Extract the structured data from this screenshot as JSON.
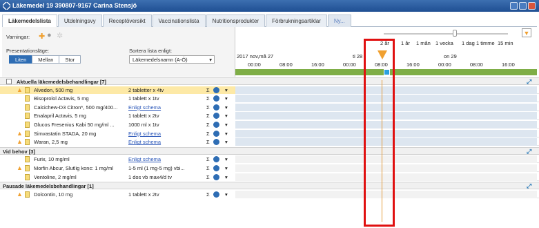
{
  "window": {
    "title": "Läkemedel 19 390807-9167 Carina Stensjö"
  },
  "tabs": [
    "Läkemedelslista",
    "Utdelningsvy",
    "Receptöversikt",
    "Vaccinationslista",
    "Nutritionsprodukter",
    "Förbrukningsartiklar",
    "Ny..."
  ],
  "controls": {
    "warnings_label": "Varningar:",
    "presentation_label": "Presentationsläge:",
    "modes": [
      "Liten",
      "Mellan",
      "Stor"
    ],
    "sort_label": "Sortera lista enligt:",
    "sort_value": "Läkemedelsnamn (A-Ö)"
  },
  "zoom": [
    "2 år",
    "1 år",
    "1 mån",
    "1 vecka",
    "1 dag",
    "1 timme",
    "15 min"
  ],
  "timeline": {
    "date_left": "2017 nov,må 27",
    "date_mid": "ti 28",
    "date_right": "on 29",
    "hours": [
      "00:00",
      "08:00",
      "16:00",
      "00:00",
      "08:00",
      "16:00",
      "00:00",
      "08:00",
      "16:00"
    ]
  },
  "sections": [
    {
      "title": "Aktuella läkemedelsbehandlingar [7]",
      "rows": [
        {
          "name": "Alvedon, 500 mg",
          "dose": "2 tabletter x 4tv",
          "warn": true,
          "link": false,
          "hl": true
        },
        {
          "name": "Bisoprolol Actavis, 5 mg",
          "dose": "1 tablett x 1tv",
          "warn": false,
          "link": false
        },
        {
          "name": "Calcichew-D3 Citron*, 500 mg/400...",
          "dose": "Enligt schema",
          "warn": false,
          "link": true
        },
        {
          "name": "Enalapril Actavis, 5 mg",
          "dose": "1 tablett x 2tv",
          "warn": false,
          "link": false
        },
        {
          "name": "Glucos Fresenius Kabi 50 mg/ml ...",
          "dose": "1000 ml x 1tv",
          "warn": false,
          "link": false
        },
        {
          "name": "Simvastatin STADA, 20 mg",
          "dose": "Enligt schema",
          "warn": true,
          "link": true
        },
        {
          "name": "Waran, 2,5 mg",
          "dose": "Enligt schema",
          "warn": true,
          "link": true
        }
      ]
    },
    {
      "title": "Vid behov [3]",
      "rows": [
        {
          "name": "Furix, 10 mg/ml",
          "dose": "Enligt schema",
          "warn": false,
          "link": true
        },
        {
          "name": "Morfin Abcur, Slutlig konc: 1 mg/ml",
          "dose": "1-5 ml (1 mg-5 mg) vbi...",
          "warn": true,
          "link": false
        },
        {
          "name": "Ventoline, 2 mg/ml",
          "dose": "1 dos vb max4/d tv",
          "warn": false,
          "link": false
        }
      ]
    },
    {
      "title": "Pausade läkemedelsbehandlingar [1]",
      "rows": [
        {
          "name": "Dolcontin, 10 mg",
          "dose": "1 tablett x 2tv",
          "warn": true,
          "link": false
        }
      ]
    }
  ],
  "colors": {
    "accent": "#2e6db4",
    "highlight_row": "#fde9a6",
    "redbox": "#e01010",
    "now_line": "#e49c3c"
  }
}
